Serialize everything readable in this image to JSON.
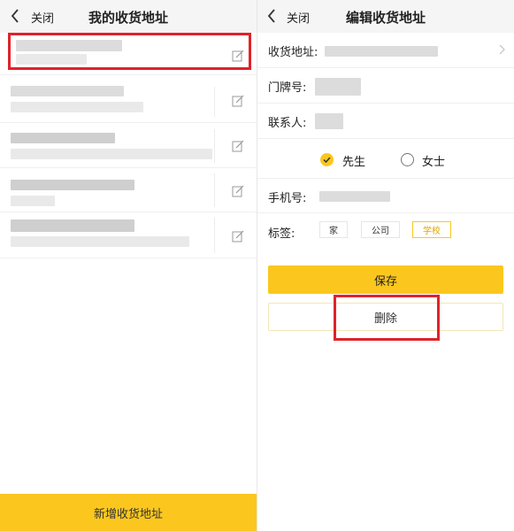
{
  "left": {
    "nav": {
      "close_label": "关闭",
      "title": "我的收货地址"
    },
    "add_button_label": "新增收货地址"
  },
  "right": {
    "nav": {
      "close_label": "关闭",
      "title": "编辑收货地址"
    },
    "form": {
      "address_label": "收货地址:",
      "house_number_label": "门牌号:",
      "contact_label": "联系人:",
      "gender_options": [
        "先生",
        "女士"
      ],
      "gender_selected": "先生",
      "phone_label": "手机号:",
      "tags_label": "标签:",
      "tags": [
        "家",
        "公司",
        "学校"
      ],
      "tag_selected": "学校"
    },
    "save_label": "保存",
    "delete_label": "删除"
  },
  "colors": {
    "accent": "#fbc71e",
    "highlight": "#e0222a",
    "navbar": "#f5f5f5"
  },
  "icons": [
    "back-arrow-icon",
    "edit-pencil-icon",
    "chevron-right-icon",
    "radio-check-icon"
  ]
}
